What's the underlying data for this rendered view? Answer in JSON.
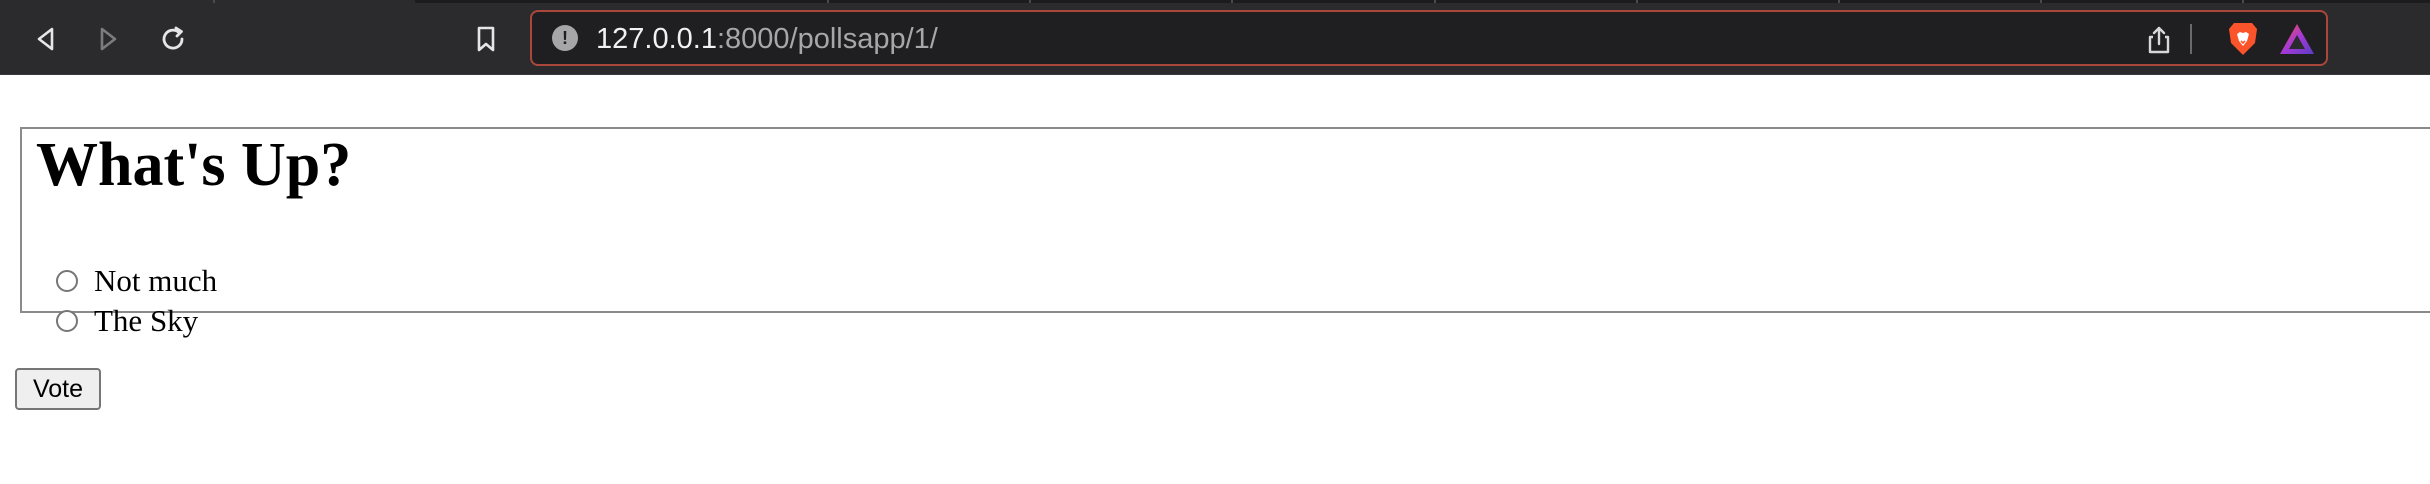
{
  "browser": {
    "url_host": "127.0.0.1",
    "url_path": ":8000/pollsapp/1/",
    "icons": {
      "back": "back-arrow-icon",
      "forward": "forward-arrow-icon",
      "reload": "reload-icon",
      "bookmark": "bookmark-icon",
      "site_info": "info-icon",
      "share": "share-icon",
      "brave": "brave-lion-icon",
      "rewards": "brave-rewards-icon"
    },
    "colors": {
      "toolbar": "#2b2b2e",
      "url_border": "#a9483a",
      "brave_orange": "#fb542b"
    }
  },
  "poll": {
    "question": "What's Up?",
    "choices": [
      {
        "label": "Not much",
        "selected": false
      },
      {
        "label": "The Sky",
        "selected": false
      }
    ],
    "vote_label": "Vote"
  }
}
